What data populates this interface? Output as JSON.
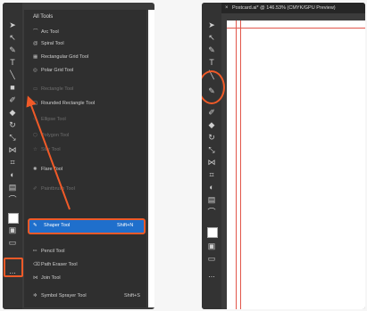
{
  "left_panel": {
    "flyout_title": "All Tools",
    "items": [
      {
        "icon": "arc-tool-icon",
        "label": "Arc Tool",
        "dim": false
      },
      {
        "icon": "spiral-tool-icon",
        "label": "Spiral Tool",
        "dim": false
      },
      {
        "icon": "rectangular-grid-tool-icon",
        "label": "Rectangular Grid Tool",
        "dim": false
      },
      {
        "icon": "polar-grid-tool-icon",
        "label": "Polar Grid Tool",
        "dim": false
      },
      {
        "icon": "rectangle-tool-icon",
        "label": "Rectangle Tool",
        "dim": true
      },
      {
        "icon": "rounded-rectangle-tool-icon",
        "label": "Rounded Rectangle Tool",
        "dim": false
      },
      {
        "icon": "ellipse-tool-icon",
        "label": "Ellipse Tool",
        "dim": true
      },
      {
        "icon": "polygon-tool-icon",
        "label": "Polygon Tool",
        "dim": true
      },
      {
        "icon": "star-tool-icon",
        "label": "Star Tool",
        "dim": true
      },
      {
        "icon": "flare-tool-icon",
        "label": "Flare Tool",
        "dim": false
      },
      {
        "icon": "paintbrush-tool-icon",
        "label": "Paintbrush Tool",
        "dim": true
      }
    ],
    "highlighted_item": {
      "label": "Shaper Tool",
      "shortcut": "Shift+N"
    },
    "items_after": [
      {
        "icon": "pencil-tool-icon",
        "label": "Pencil Tool",
        "dim": false
      },
      {
        "icon": "path-eraser-tool-icon",
        "label": "Path Eraser Tool",
        "dim": false
      },
      {
        "icon": "join-tool-icon",
        "label": "Join Tool",
        "dim": false
      },
      {
        "icon": "symbol-sprayer-tool-icon",
        "label": "Symbol Sprayer Tool",
        "dim": false,
        "shortcut": "Shift+S"
      }
    ],
    "edit_toolbar_label": "..."
  },
  "right_panel": {
    "doc_tab_title": "Postcard.ai* @ 146.53% (CMYK/GPU Preview)",
    "close_glyph": "×"
  },
  "colors": {
    "accent_orange": "#f05a28",
    "highlight_blue": "#1f6fcc",
    "panel_dark": "#3b3b3b",
    "guide_red": "#e2564b"
  }
}
